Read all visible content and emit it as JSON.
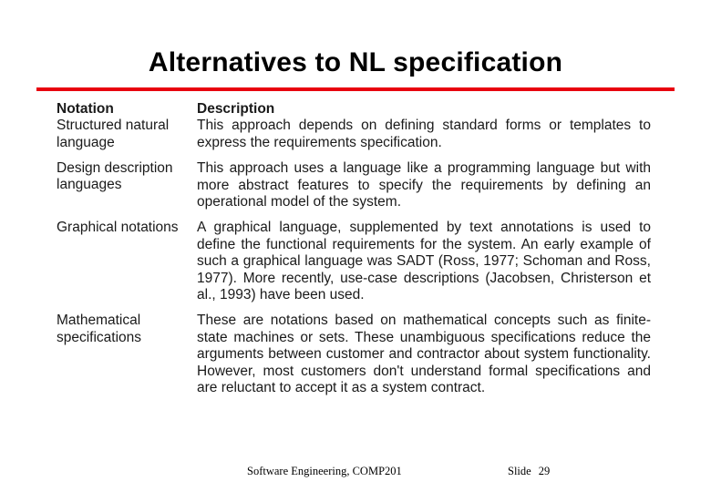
{
  "slide": {
    "title": "Alternatives to NL specification",
    "accent_color": "#e8000f",
    "table": {
      "headers": {
        "notation": "Notation",
        "description": "Description"
      },
      "rows": [
        {
          "notation": "Structured natural language",
          "description": "This approach depends on defining standard forms or templates to express the requirements specification."
        },
        {
          "notation": "Design description languages",
          "description": "This approach uses a language like a programming language but with more abstract features to specify the requirements by defining an operational model of the system."
        },
        {
          "notation": "Graphical notations",
          "description": "A graphical language, supplemented by text annotations is used to define the functional requirements for the system. An early example of such a graphical language was SADT (Ross, 1977; Schoman and Ross, 1977). More recently, use-case descriptions (Jacobsen, Christerson et al., 1993) have been used."
        },
        {
          "notation": "Mathematical specifications",
          "description": " These are notations based on mathematical concepts such as finite-state machines or sets. These unambiguous specifications reduce the arguments between customer and contractor about system functionality. However, most customers don't understand formal specifications and are reluctant to accept it as a system contract."
        }
      ]
    },
    "footer": {
      "course": "Software Engineering, COMP201",
      "slide_label": "Slide",
      "slide_number": "29"
    }
  }
}
